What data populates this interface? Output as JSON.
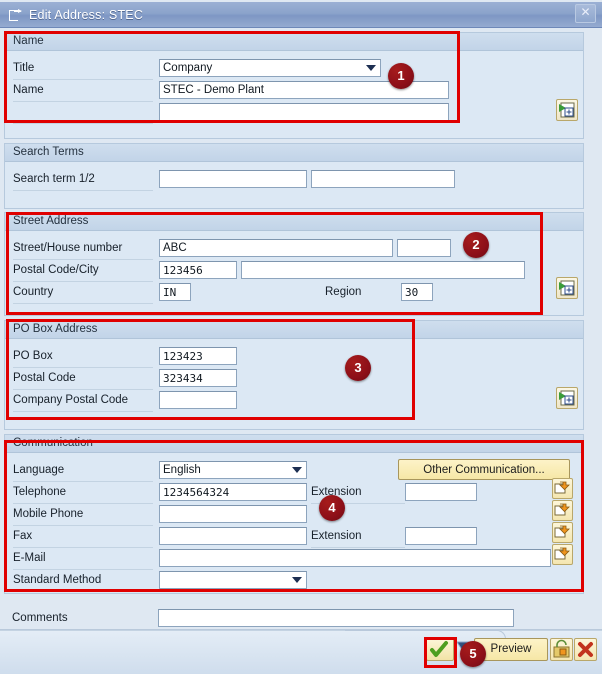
{
  "window": {
    "title": "Edit Address:  STEC",
    "title_icon": "edit-address-icon",
    "close_label": "✕"
  },
  "sections": {
    "name": {
      "header": "Name",
      "fields": {
        "title_label": "Title",
        "title_value": "Company",
        "name_label": "Name",
        "name_value": "STEC - Demo Plant",
        "name2_value": ""
      }
    },
    "search_terms": {
      "header": "Search Terms",
      "fields": {
        "search_label": "Search term 1/2",
        "search1_value": "",
        "search2_value": ""
      }
    },
    "street_address": {
      "header": "Street Address",
      "fields": {
        "street_label": "Street/House number",
        "street_value": "ABC",
        "house_value": "",
        "postal_city_label": "Postal Code/City",
        "postal_value": "123456",
        "city_value": "",
        "country_label": "Country",
        "country_value": "IN",
        "region_label": "Region",
        "region_value": "30"
      }
    },
    "po_box": {
      "header": "PO Box Address",
      "fields": {
        "pobox_label": "PO Box",
        "pobox_value": "123423",
        "postal_label": "Postal Code",
        "postal_value": "323434",
        "company_postal_label": "Company Postal Code",
        "company_postal_value": ""
      }
    },
    "communication": {
      "header": "Communication",
      "other_button": "Other Communication...",
      "fields": {
        "language_label": "Language",
        "language_value": "English",
        "telephone_label": "Telephone",
        "telephone_value": "1234564324",
        "telephone_ext_label": "Extension",
        "telephone_ext_value": "",
        "mobile_label": "Mobile Phone",
        "mobile_value": "",
        "fax_label": "Fax",
        "fax_value": "",
        "fax_ext_label": "Extension",
        "fax_ext_value": "",
        "email_label": "E-Mail",
        "email_value": "",
        "standard_method_label": "Standard Method",
        "standard_method_value": ""
      }
    },
    "comments": {
      "label": "Comments",
      "value": ""
    }
  },
  "footer": {
    "ok_icon": "green-check-icon",
    "ok_dropdown_icon": "dropdown-arrow-icon",
    "preview_label": "Preview",
    "hold_icon": "hold-lock-icon",
    "cancel_icon": "red-x-icon"
  },
  "side_icons": {
    "name_expand": "insert-line-icon",
    "street_expand": "insert-line-icon",
    "pobox_expand": "insert-line-icon",
    "comm_launch_1": "launch-arrow-icon",
    "comm_launch_2": "launch-arrow-icon",
    "comm_launch_3": "launch-arrow-icon",
    "comm_launch_4": "launch-arrow-icon"
  },
  "markers": {
    "m1": "1",
    "m2": "2",
    "m3": "3",
    "m4": "4",
    "m5": "5"
  },
  "colors": {
    "annotation_red": "#e00000",
    "marker_fill": "#8d0f18",
    "titlebar": "#8ba3cb",
    "panel_bg": "#dce8f4",
    "button_yellow": "#f6e7a6"
  }
}
